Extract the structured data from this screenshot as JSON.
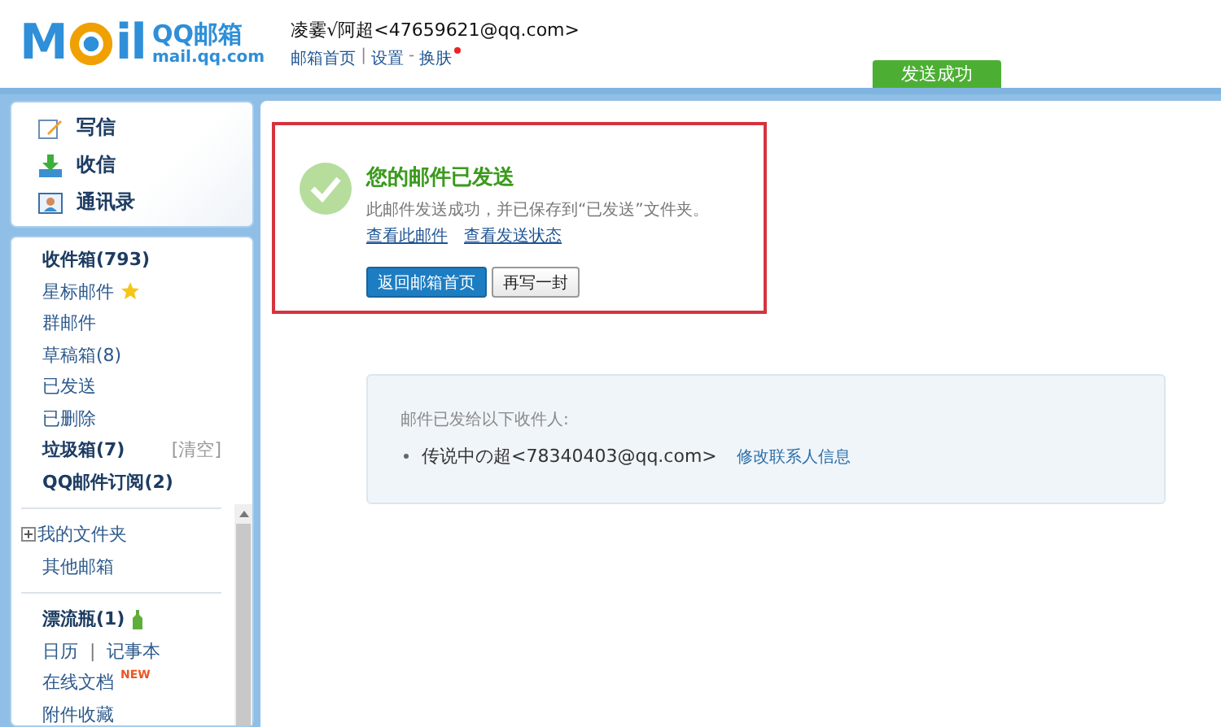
{
  "header": {
    "logo": {
      "left": "M",
      "right": "il",
      "wordmark": "QQ邮箱",
      "domain": "mail.qq.com"
    },
    "account": "凌霎√阿超<47659621@qq.com>",
    "links": [
      {
        "label": "邮箱首页",
        "kind": "link"
      },
      {
        "label": "|",
        "kind": "sep"
      },
      {
        "label": "设置",
        "kind": "link"
      },
      {
        "label": "-",
        "kind": "sep"
      },
      {
        "label": "换肤",
        "kind": "link",
        "notify": true
      }
    ],
    "status_badge": "发送成功"
  },
  "sidebar": {
    "actions": [
      {
        "label": "写信",
        "kind": "compose"
      },
      {
        "label": "收信",
        "kind": "receive"
      },
      {
        "label": "通讯录",
        "kind": "contacts"
      }
    ],
    "groups": [
      {
        "items": [
          {
            "label": "收件箱(793)",
            "kind": "bold"
          },
          {
            "label": "星标邮件",
            "kind": "starred"
          },
          {
            "label": "群邮件",
            "kind": "plain"
          },
          {
            "label": "草稿箱(8)",
            "kind": "plain"
          },
          {
            "label": "已发送",
            "kind": "plain"
          },
          {
            "label": "已删除",
            "kind": "plain"
          },
          {
            "label": "垃圾箱(7)",
            "kind": "bold",
            "action": "[清空]"
          },
          {
            "label": "QQ邮件订阅(2)",
            "kind": "bold"
          }
        ]
      },
      {
        "items": [
          {
            "label": "我的文件夹",
            "kind": "tree",
            "expanded": false
          },
          {
            "label": "其他邮箱",
            "kind": "plain"
          }
        ]
      },
      {
        "items": [
          {
            "label": "漂流瓶(1)",
            "kind": "bottle"
          },
          {
            "label": "日历",
            "kind": "plain",
            "separator": "|",
            "label2": "记事本"
          },
          {
            "label": "在线文档",
            "kind": "plain",
            "badge": "NEW"
          },
          {
            "label": "附件收藏",
            "kind": "plain"
          }
        ]
      }
    ]
  },
  "main": {
    "notice": {
      "title": "您的邮件已发送",
      "message": "此邮件发送成功，并已保存到“已发送”文件夹。",
      "links": [
        "查看此邮件",
        "查看发送状态"
      ],
      "buttons": [
        {
          "label": "返回邮箱首页",
          "kind": "primary"
        },
        {
          "label": "再写一封",
          "kind": "default"
        }
      ]
    },
    "recipients": {
      "heading": "邮件已发给以下收件人:",
      "items": [
        {
          "name": "传说中の超<78340403@qq.com>",
          "action": "修改联系人信息"
        }
      ]
    }
  }
}
